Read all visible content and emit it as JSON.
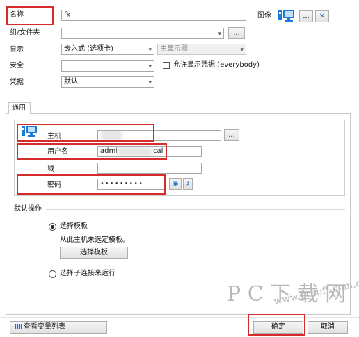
{
  "form": {
    "name_label": "名称",
    "name_value": "fk",
    "image_label": "图像",
    "group_label": "组/文件夹",
    "display_label": "显示",
    "display_value": "嵌入式 (选项卡)",
    "monitor_value": "主显示器",
    "security_label": "安全",
    "security_value": "",
    "allow_creds_label": "允许显示凭据 (everybody)",
    "credential_label": "凭据",
    "credential_value": "默认",
    "more_button": "...",
    "delete_icon": "✕"
  },
  "tab": {
    "label": "通用"
  },
  "general": {
    "host_label": "主机",
    "username_label": "用户名",
    "username_value_start": "admi",
    "username_value_end": "cal",
    "domain_label": "域",
    "password_label": "密码",
    "password_value": "•••••••••"
  },
  "default_action": {
    "title": "默认操作",
    "select_template_label": "选择模板",
    "template_note": "从此主机未选定模板。",
    "select_template_button": "选择模板",
    "select_child_label": "选择子连接来运行"
  },
  "footer": {
    "view_variables_label": "查看变量列表",
    "ok_label": "确定",
    "cancel_label": "取消"
  },
  "watermark": {
    "line1": "P C 下 载 网",
    "line2": "www.pcsoft.com.cn"
  },
  "colors": {
    "highlight_red": "#d62b2b",
    "accent_blue": "#1e7ad6"
  }
}
